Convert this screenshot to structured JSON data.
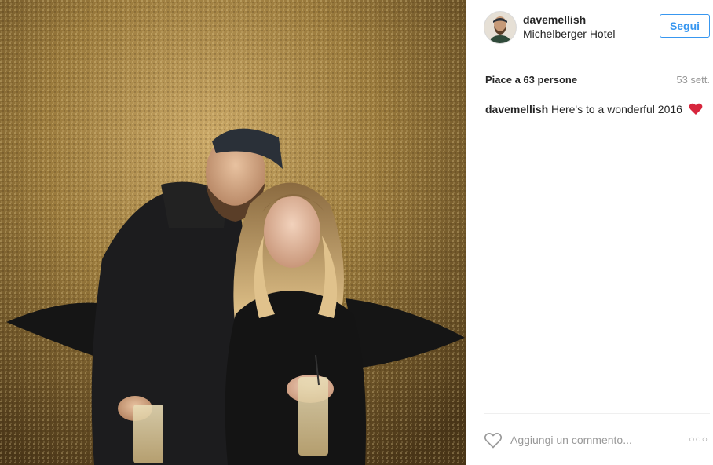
{
  "post": {
    "username": "davemellish",
    "location": "Michelberger Hotel",
    "follow_label": "Segui",
    "likes_text": "Piace a 63 persone",
    "time_ago": "53 sett.",
    "caption_user": "davemellish",
    "caption_text": "Here's to a wonderful 2016",
    "comment_placeholder": "Aggiungi un commento...",
    "more_glyph": "○○○"
  },
  "icons": {
    "heart_outline": "heart-outline-icon",
    "heart_emoji": "red-heart-icon",
    "more": "more-options-icon"
  },
  "colors": {
    "accent": "#3897f0",
    "text": "#262626",
    "muted": "#999999",
    "emoji_red": "#d7263d"
  }
}
